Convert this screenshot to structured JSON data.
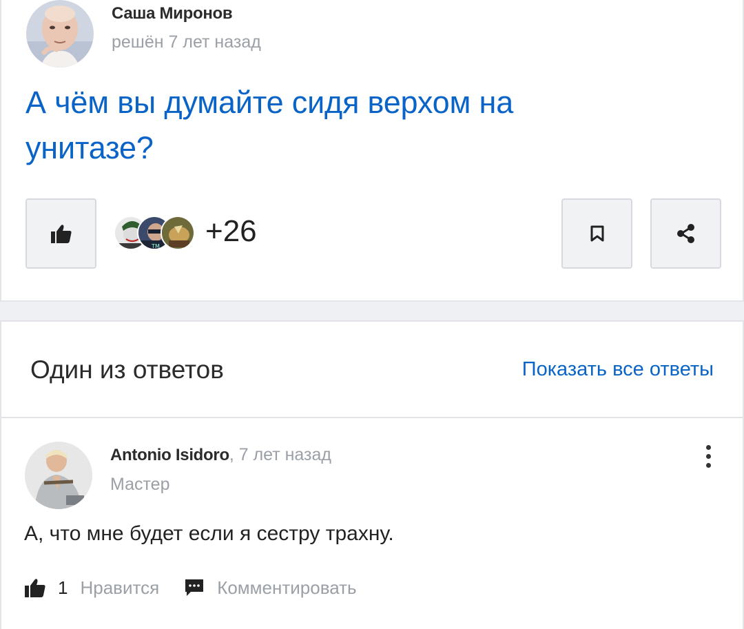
{
  "question": {
    "author": "Саша Миронов",
    "status": "решён 7 лет назад",
    "title": "А чём вы думайте сидя верхом на унитазе?",
    "likes_extra": "+26"
  },
  "answers_section": {
    "title": "Один из ответов",
    "show_all": "Показать все ответы"
  },
  "answer": {
    "author": "Antonio Isidoro",
    "separator": ",",
    "time": "7 лет назад",
    "rank": "Мастер",
    "text": "А, что мне будет если я сестру трахну.",
    "like_count": "1",
    "like_label": "Нравится",
    "comment_label": "Комментировать"
  },
  "icons": {
    "like": "thumbs-up-icon",
    "bookmark": "bookmark-icon",
    "share": "share-icon",
    "more": "kebab-menu-icon",
    "comment": "comment-icon"
  },
  "colors": {
    "accent": "#0a64c8",
    "muted": "#9aa0a6",
    "button_bg": "#f1f2f4",
    "border": "#d7d9de"
  }
}
